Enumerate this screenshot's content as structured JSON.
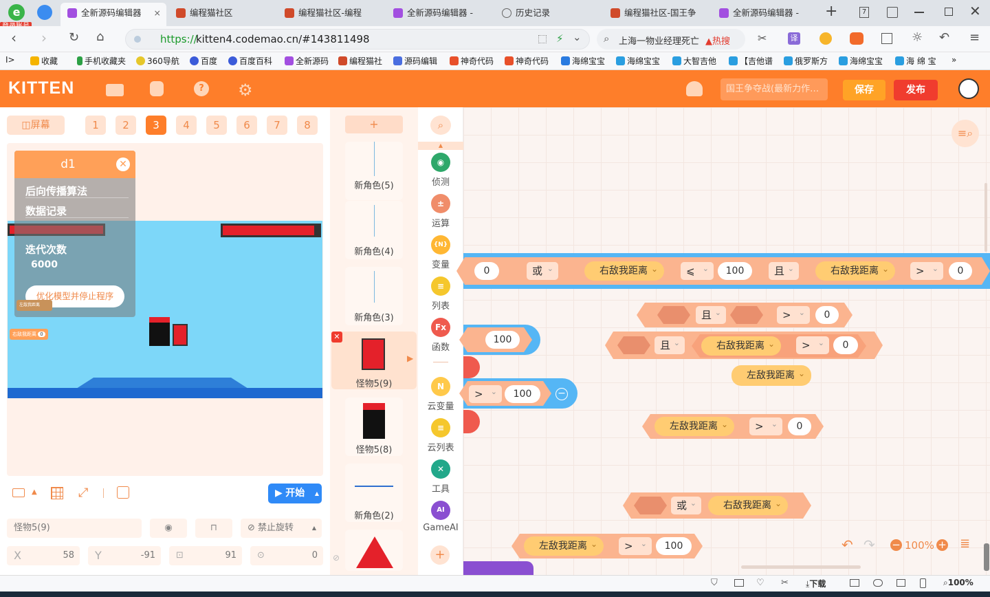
{
  "browser": {
    "login_badge": "登录账号",
    "tabs": [
      "全新源码编辑器",
      "编程猫社区",
      "编程猫社区-编程",
      "全新源码编辑器 -",
      "历史记录",
      "编程猫社区-国王争",
      "全新源码编辑器 -"
    ],
    "tab_close": "×",
    "new_tab": "+",
    "url_prefix": "https://",
    "url": "kitten4.codemao.cn/#143811498",
    "search_text": "上海一物业经理死亡",
    "hot_label": "热搜",
    "translate": "译",
    "badge_num": "7",
    "bookmarks_toggle": "I>",
    "bookmarks": [
      "收藏",
      "手机收藏夹",
      "360导航",
      "百度",
      "百度百科",
      "全新源码",
      "编程猫社",
      "源码编辑",
      "神奇代码",
      "神奇代码",
      "海绵宝宝",
      "海绵宝宝",
      "大智吉他",
      "【吉他谱",
      "俄罗斯方",
      "海绵宝宝",
      "海 绵 宝"
    ],
    "more": "»"
  },
  "app": {
    "logo": "KITTEN",
    "project_title": "国王争夺战(最新力作…",
    "save": "保存",
    "publish": "发布"
  },
  "stage": {
    "screen_btn": "屏幕",
    "scenes": [
      "1",
      "2",
      "3",
      "4",
      "5",
      "6",
      "7",
      "8"
    ],
    "selected_scene": "3",
    "panel": {
      "title": "d1",
      "items": [
        "后向传播算法",
        "数据记录",
        "迭代次数"
      ],
      "value": "6000",
      "button": "优化模型并停止程序"
    },
    "var_left": "右敌我距离",
    "var_left_val": "0",
    "var_small": "左敌我距离",
    "start": "开始"
  },
  "props": {
    "sprite_name": "怪物5(9)",
    "rotate": "禁止旋转",
    "x_label": "X",
    "x": "58",
    "y_label": "Y",
    "y": "-91",
    "size": "91",
    "dir": "0"
  },
  "sprites": {
    "add": "+",
    "items": [
      "新角色(5)",
      "新角色(4)",
      "新角色(3)",
      "怪物5(9)",
      "怪物5(8)",
      "新角色(2)"
    ]
  },
  "categories": [
    {
      "label": "侦测",
      "color": "#2ea86a",
      "sym": "◉"
    },
    {
      "label": "运算",
      "color": "#f08d6a",
      "sym": "±"
    },
    {
      "label": "变量",
      "color": "#ffb733",
      "sym": "{N}"
    },
    {
      "label": "列表",
      "color": "#f5c72c",
      "sym": "≡"
    },
    {
      "label": "函数",
      "color": "#ef5a4e",
      "sym": "Fx"
    },
    {
      "label": "云变量",
      "color": "#ffc94a",
      "sym": "N"
    },
    {
      "label": "云列表",
      "color": "#f5c72c",
      "sym": "≡"
    },
    {
      "label": "工具",
      "color": "#22a88a",
      "sym": "✕"
    },
    {
      "label": "GameAI",
      "color": "#8a4fd1",
      "sym": "AI"
    }
  ],
  "blocks": {
    "row1": {
      "n0": "0",
      "or": "或",
      "v1": "右敌我距离",
      "op1": "⩽",
      "n1": "100",
      "and": "且",
      "v2": "右敌我距离",
      "op2": ">",
      "n2": "0"
    },
    "left1": {
      "n": "100"
    },
    "left2": {
      "op": ">",
      "n": "100"
    },
    "b_and1": {
      "and": "且",
      "op": ">",
      "n": "0"
    },
    "b_and2": {
      "and": "且",
      "v": "右敌我距离",
      "op": ">",
      "n": "0"
    },
    "b_left": {
      "v": "左敌我距离"
    },
    "b_cmp": {
      "v": "左敌我距离",
      "op": ">",
      "n": "0"
    },
    "b_or": {
      "or": "或",
      "v": "右敌我距离"
    },
    "b_cmp2": {
      "v": "左敌我距离",
      "op": ">",
      "n": "100"
    },
    "zoom": "100%"
  },
  "status": {
    "download": "下载",
    "zoom": "100%"
  }
}
